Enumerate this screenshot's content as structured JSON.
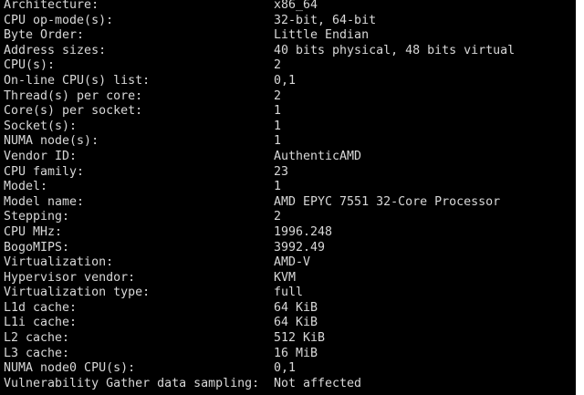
{
  "terminal": {
    "rows": [
      {
        "key": "Architecture:",
        "value": "x86_64"
      },
      {
        "key": "CPU op-mode(s):",
        "value": "32-bit, 64-bit"
      },
      {
        "key": "Byte Order:",
        "value": "Little Endian"
      },
      {
        "key": "Address sizes:",
        "value": "40 bits physical, 48 bits virtual"
      },
      {
        "key": "CPU(s):",
        "value": "2"
      },
      {
        "key": "On-line CPU(s) list:",
        "value": "0,1"
      },
      {
        "key": "Thread(s) per core:",
        "value": "2"
      },
      {
        "key": "Core(s) per socket:",
        "value": "1"
      },
      {
        "key": "Socket(s):",
        "value": "1"
      },
      {
        "key": "NUMA node(s):",
        "value": "1"
      },
      {
        "key": "Vendor ID:",
        "value": "AuthenticAMD"
      },
      {
        "key": "CPU family:",
        "value": "23"
      },
      {
        "key": "Model:",
        "value": "1"
      },
      {
        "key": "Model name:",
        "value": "AMD EPYC 7551 32-Core Processor"
      },
      {
        "key": "Stepping:",
        "value": "2"
      },
      {
        "key": "CPU MHz:",
        "value": "1996.248"
      },
      {
        "key": "BogoMIPS:",
        "value": "3992.49"
      },
      {
        "key": "Virtualization:",
        "value": "AMD-V"
      },
      {
        "key": "Hypervisor vendor:",
        "value": "KVM"
      },
      {
        "key": "Virtualization type:",
        "value": "full"
      },
      {
        "key": "L1d cache:",
        "value": "64 KiB"
      },
      {
        "key": "L1i cache:",
        "value": "64 KiB"
      },
      {
        "key": "L2 cache:",
        "value": "512 KiB"
      },
      {
        "key": "L3 cache:",
        "value": "16 MiB"
      },
      {
        "key": "NUMA node0 CPU(s):",
        "value": "0,1"
      },
      {
        "key": "Vulnerability Gather data sampling:",
        "value": "Not affected"
      }
    ]
  },
  "colors": {
    "background": "#000000",
    "text": "#d8d8d8"
  }
}
